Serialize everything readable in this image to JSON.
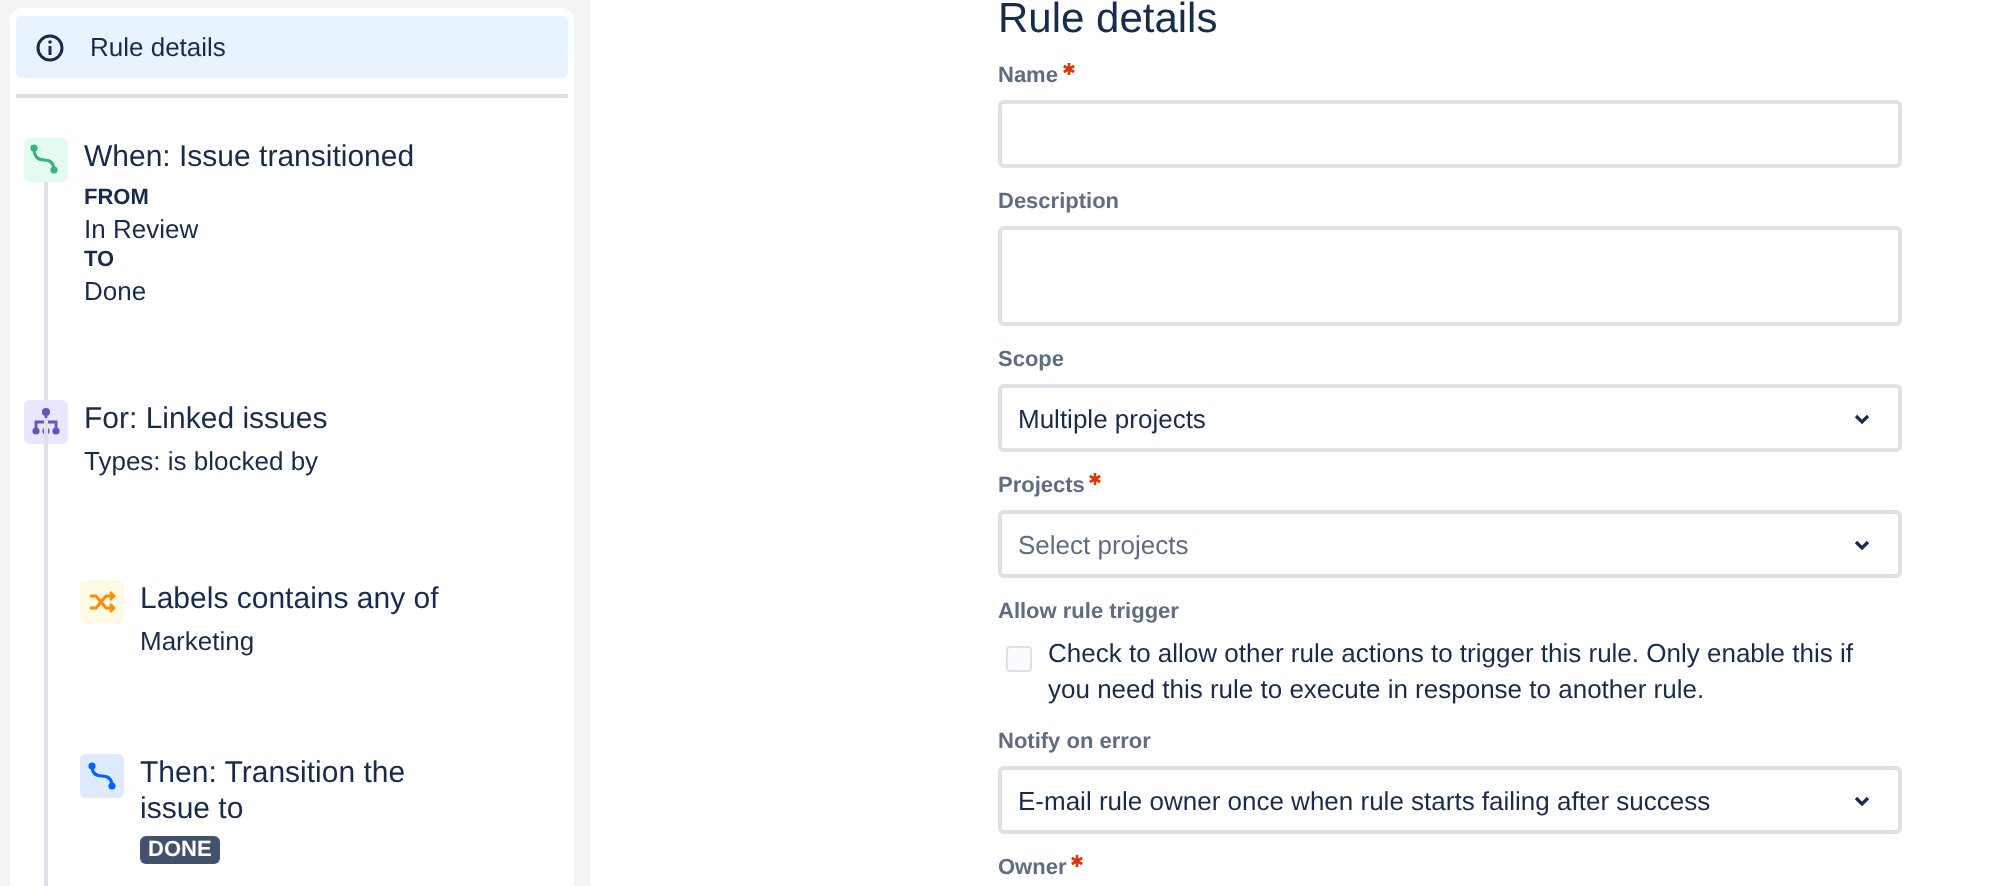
{
  "sidebar": {
    "header": {
      "label": "Rule details",
      "selected": true
    },
    "steps": [
      {
        "kind": "trigger",
        "title": "When: Issue transitioned",
        "details": [
          {
            "kind": "label",
            "text": "FROM"
          },
          {
            "kind": "value",
            "text": "In Review"
          },
          {
            "kind": "label",
            "text": "TO"
          },
          {
            "kind": "value",
            "text": "Done"
          }
        ]
      },
      {
        "kind": "branch",
        "title": "For: Linked issues",
        "details": [
          {
            "kind": "value",
            "text": "Types: is blocked by"
          }
        ],
        "children": [
          {
            "kind": "condition",
            "title": "Labels contains any of",
            "details": [
              {
                "kind": "value",
                "text": "Marketing"
              }
            ]
          },
          {
            "kind": "action",
            "title": "Then: Transition the issue to",
            "details": [
              {
                "kind": "lozenge",
                "text": "DONE"
              }
            ]
          }
        ]
      }
    ]
  },
  "form": {
    "title": "Rule details",
    "fields": [
      {
        "kind": "text",
        "label": "Name",
        "required": true
      },
      {
        "kind": "textarea",
        "label": "Description",
        "required": false
      },
      {
        "kind": "select",
        "label": "Scope",
        "required": false,
        "value": "Multiple projects"
      },
      {
        "kind": "select",
        "label": "Projects",
        "required": true,
        "placeholder": "Select projects"
      },
      {
        "kind": "checkbox",
        "label": "Allow rule trigger",
        "required": false,
        "checked": false,
        "text": "Check to allow other rule actions to trigger this rule. Only enable this if you need this rule to execute in response to another rule."
      },
      {
        "kind": "select",
        "label": "Notify on error",
        "required": false,
        "value": "E-mail rule owner once when rule starts failing after success"
      },
      {
        "kind": "label_only",
        "label": "Owner",
        "required": true
      }
    ]
  }
}
